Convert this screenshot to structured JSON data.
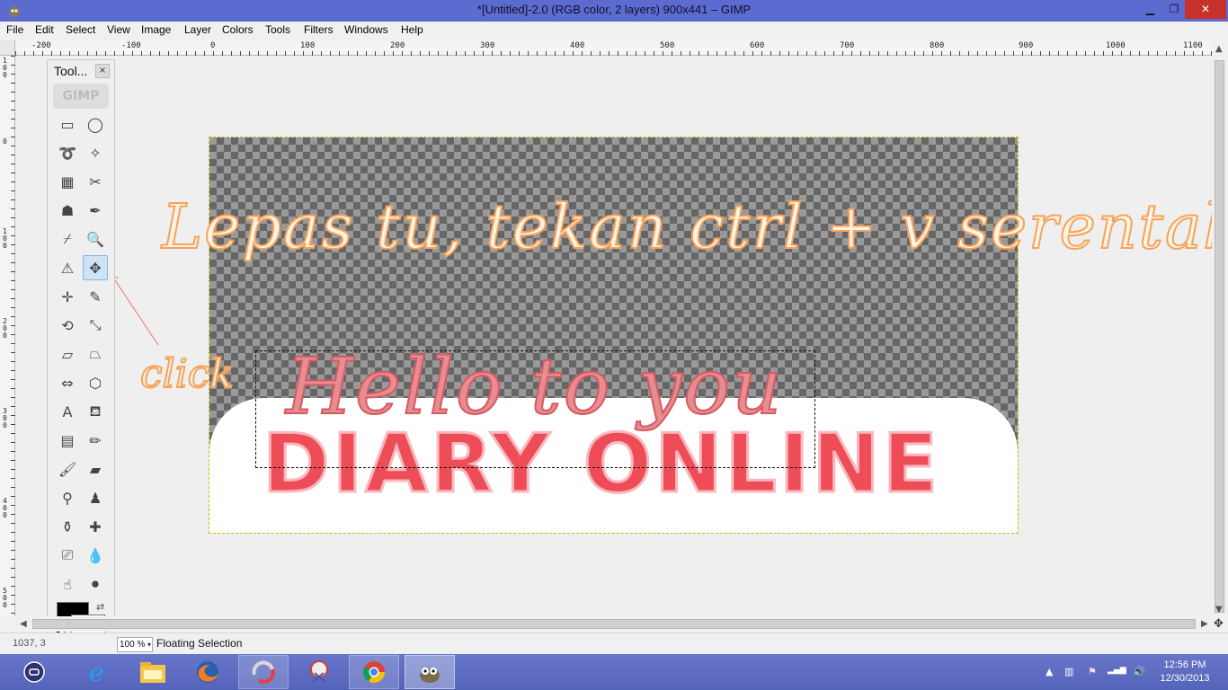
{
  "window": {
    "title": "*[Untitled]-2.0 (RGB color, 2 layers) 900x441 – GIMP",
    "min_label": "▁",
    "max_label": "❐",
    "close_label": "✕"
  },
  "menu": [
    "File",
    "Edit",
    "Select",
    "View",
    "Image",
    "Layer",
    "Colors",
    "Tools",
    "Filters",
    "Windows",
    "Help"
  ],
  "ruler": {
    "h_labels": [
      "-200",
      "-100",
      "0",
      "100",
      "200",
      "300",
      "400",
      "500",
      "600",
      "700",
      "800",
      "900",
      "1000",
      "1100"
    ],
    "v_labels": [
      "1\n0\n0",
      "0",
      "1\n0\n0",
      "2\n0\n0",
      "3\n0\n0",
      "4\n0\n0",
      "5\n0\n0"
    ]
  },
  "toolbox": {
    "title": "Tool...",
    "close_label": "×",
    "logo_label": "GIMP",
    "tools": [
      {
        "name": "rect-select-icon",
        "glyph": "▭"
      },
      {
        "name": "ellipse-select-icon",
        "glyph": "◯"
      },
      {
        "name": "free-select-icon",
        "glyph": "➰"
      },
      {
        "name": "fuzzy-select-icon",
        "glyph": "✧"
      },
      {
        "name": "select-by-color-icon",
        "glyph": "▦"
      },
      {
        "name": "scissors-select-icon",
        "glyph": "✂"
      },
      {
        "name": "foreground-select-icon",
        "glyph": "☗"
      },
      {
        "name": "paths-icon",
        "glyph": "✒"
      },
      {
        "name": "color-picker-icon",
        "glyph": "⌿"
      },
      {
        "name": "zoom-icon",
        "glyph": "🔍"
      },
      {
        "name": "measure-icon",
        "glyph": "⚠"
      },
      {
        "name": "move-icon",
        "glyph": "✥",
        "active": true
      },
      {
        "name": "align-icon",
        "glyph": "✛"
      },
      {
        "name": "crop-icon",
        "glyph": "✎"
      },
      {
        "name": "rotate-icon",
        "glyph": "⟲"
      },
      {
        "name": "scale-icon",
        "glyph": "⤡"
      },
      {
        "name": "shear-icon",
        "glyph": "▱"
      },
      {
        "name": "perspective-icon",
        "glyph": "⏢"
      },
      {
        "name": "flip-icon",
        "glyph": "⇔"
      },
      {
        "name": "cage-transform-icon",
        "glyph": "⬡"
      },
      {
        "name": "text-icon",
        "glyph": "A"
      },
      {
        "name": "bucket-fill-icon",
        "glyph": "⛾"
      },
      {
        "name": "blend-icon",
        "glyph": "▤"
      },
      {
        "name": "pencil-icon",
        "glyph": "✏"
      },
      {
        "name": "paintbrush-icon",
        "glyph": "🖌"
      },
      {
        "name": "eraser-icon",
        "glyph": "▰"
      },
      {
        "name": "airbrush-icon",
        "glyph": "⚲"
      },
      {
        "name": "ink-icon",
        "glyph": "♟"
      },
      {
        "name": "clone-icon",
        "glyph": "⚱"
      },
      {
        "name": "heal-icon",
        "glyph": "✚"
      },
      {
        "name": "perspective-clone-icon",
        "glyph": "⎚"
      },
      {
        "name": "blur-icon",
        "glyph": "💧"
      },
      {
        "name": "smudge-icon",
        "glyph": "☝"
      },
      {
        "name": "dodge-burn-icon",
        "glyph": "⚫"
      }
    ],
    "swap_label": "⇄",
    "fg_color": "#000000",
    "bg_color": "#ffffff"
  },
  "canvas": {
    "hello_text": "Hello to you",
    "diary_text": "DIARY ONLINE",
    "annotation_main": "Lepas tu, tekan ctrl + v serentak",
    "annotation_click": "click"
  },
  "status": {
    "coords": "1037, 3",
    "zoom": "100 %",
    "zoom_arrow": "▾",
    "message": "Floating Selection"
  },
  "scroll": {
    "up": "▲",
    "down": "▼",
    "left": "◀",
    "right": "▶",
    "nav": "✥"
  },
  "taskbar": {
    "apps": [
      {
        "name": "taskbar-start-button",
        "glyph": "⊜"
      },
      {
        "name": "taskbar-ie-icon",
        "glyph": "e"
      },
      {
        "name": "taskbar-explorer-icon",
        "glyph": "🗂"
      },
      {
        "name": "taskbar-firefox-icon",
        "glyph": "🦊"
      },
      {
        "name": "taskbar-app-icon",
        "glyph": "⟳"
      },
      {
        "name": "taskbar-snipping-icon",
        "glyph": "✂"
      },
      {
        "name": "taskbar-chrome-icon",
        "glyph": "◉"
      },
      {
        "name": "taskbar-gimp-icon",
        "glyph": "🐾"
      }
    ],
    "tray": [
      "▲",
      "▥",
      "⚑",
      "▂▄▆",
      "🔊"
    ],
    "time": "12:56 PM",
    "date": "12/30/2013"
  },
  "colors": {
    "accent": "#5c6bcf",
    "close_red": "#c7312c",
    "text_pink": "#ee4d57",
    "annotation_orange": "#f5a35a"
  }
}
